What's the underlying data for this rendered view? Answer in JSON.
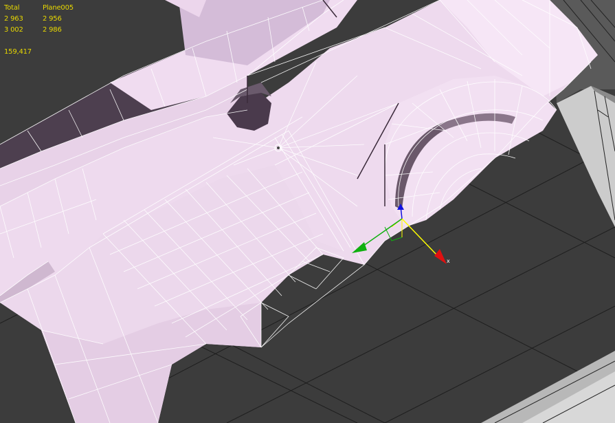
{
  "viewport": {
    "background_color": "#3c3c3c",
    "grid_color": "#1e1e1e",
    "mesh_fill_color": "#eed9ee",
    "mesh_shadow_color": "#5a4a5a",
    "wireframe_color": "#ffffff",
    "stats_color": "#e8d800"
  },
  "stats": {
    "header_total": "Total",
    "header_object": "Plane005",
    "polys_total": "2 963",
    "polys_object": "2 956",
    "verts_total": "3 002",
    "verts_object": "2 986",
    "fps": "159,417"
  },
  "gizmo": {
    "x_label": "x",
    "x_color": "#e01010",
    "y_color": "#10b010",
    "z_color": "#1010e0",
    "selected_axis_color": "#ffff00"
  }
}
